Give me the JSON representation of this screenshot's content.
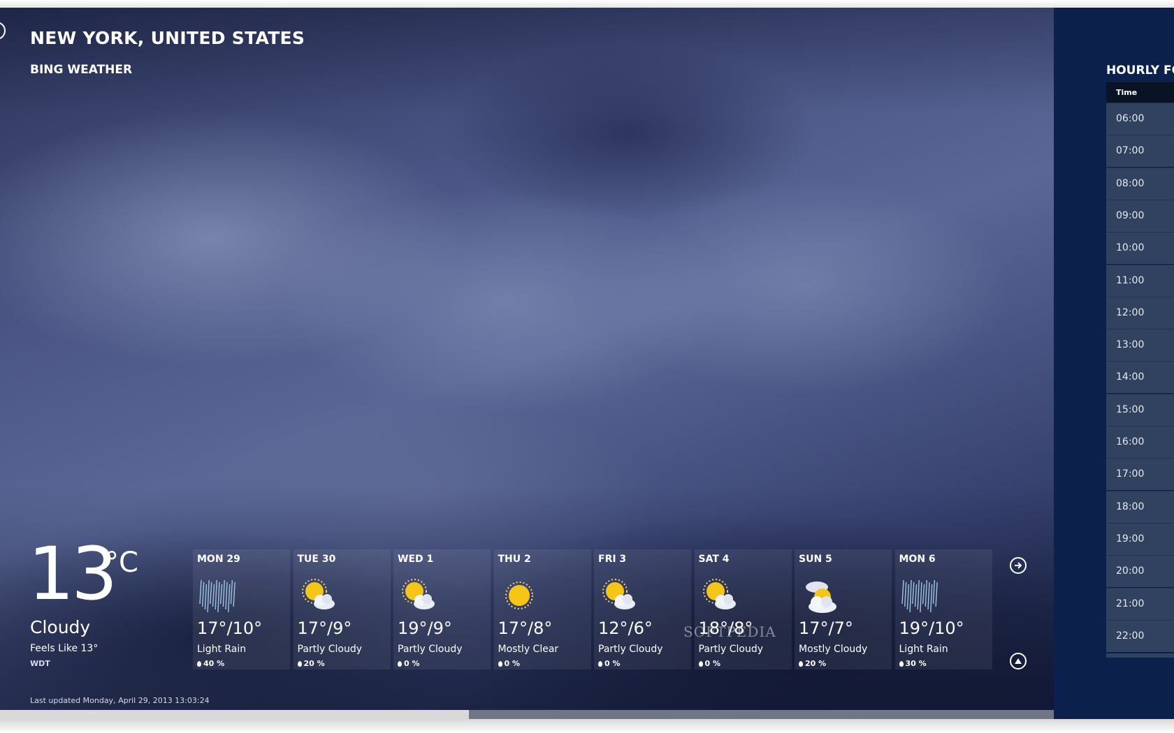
{
  "header": {
    "city": "NEW YORK, UNITED STATES",
    "brand": "BING WEATHER"
  },
  "current": {
    "temperature": "13",
    "unit": "°C",
    "condition": "Cloudy",
    "feels_like": "Feels Like 13°",
    "source": "WDT"
  },
  "forecast": [
    {
      "day": "MON 29",
      "range": "17°/10°",
      "condition": "Light Rain",
      "precip": "40 %",
      "icon": "rain-icon"
    },
    {
      "day": "TUE 30",
      "range": "17°/9°",
      "condition": "Partly Cloudy",
      "precip": "20 %",
      "icon": "partly-cloudy-icon"
    },
    {
      "day": "WED 1",
      "range": "19°/9°",
      "condition": "Partly Cloudy",
      "precip": "0 %",
      "icon": "partly-cloudy-icon"
    },
    {
      "day": "THU 2",
      "range": "17°/8°",
      "condition": "Mostly Clear",
      "precip": "0 %",
      "icon": "sun-icon"
    },
    {
      "day": "FRI 3",
      "range": "12°/6°",
      "condition": "Partly Cloudy",
      "precip": "0 %",
      "icon": "partly-cloudy-icon"
    },
    {
      "day": "SAT 4",
      "range": "18°/8°",
      "condition": "Partly Cloudy",
      "precip": "0 %",
      "icon": "partly-cloudy-icon"
    },
    {
      "day": "SUN 5",
      "range": "17°/7°",
      "condition": "Mostly Cloudy",
      "precip": "20 %",
      "icon": "mostly-cloudy-icon"
    },
    {
      "day": "MON 6",
      "range": "19°/10°",
      "condition": "Light Rain",
      "precip": "30 %",
      "icon": "rain-icon"
    }
  ],
  "last_updated": "Last updated Monday, April 29, 2013 13:03:24",
  "watermark": "SOFTPEDIA",
  "hourly": {
    "title": "HOURLY FO",
    "column_header": "Time",
    "times": [
      "06:00",
      "07:00",
      "08:00",
      "09:00",
      "10:00",
      "11:00",
      "12:00",
      "13:00",
      "14:00",
      "15:00",
      "16:00",
      "17:00",
      "18:00",
      "19:00",
      "20:00",
      "21:00",
      "22:00"
    ]
  },
  "scroll": {
    "position_fraction": 0.445
  },
  "colors": {
    "panel_bg": "#0b214b",
    "row_bg": "#30425f",
    "sun": "#f5c518"
  }
}
